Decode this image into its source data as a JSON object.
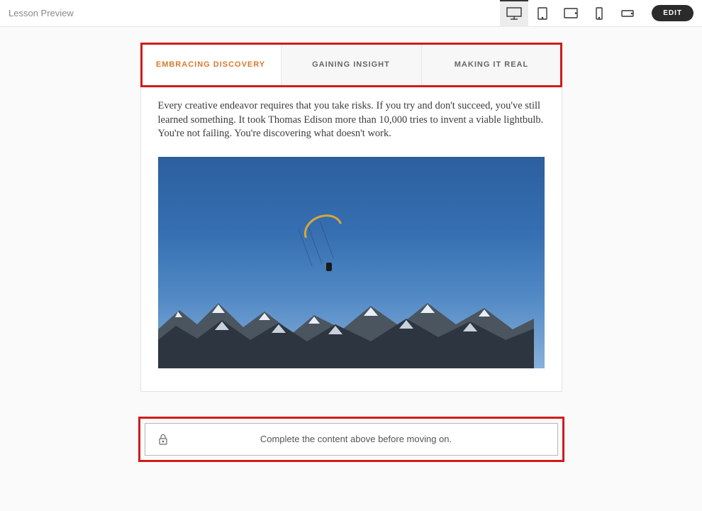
{
  "topbar": {
    "title": "Lesson Preview",
    "edit_label": "EDIT"
  },
  "tabs": [
    {
      "label": "EMBRACING DISCOVERY",
      "active": true
    },
    {
      "label": "GAINING INSIGHT",
      "active": false
    },
    {
      "label": "MAKING IT REAL",
      "active": false
    }
  ],
  "body_text": "Every creative endeavor requires that you take risks. If you try and don't succeed, you've still learned something. It took Thomas Edison more than 10,000 tries to invent a viable lightbulb. You're not failing. You're discovering what doesn't work.",
  "lock_message": "Complete the content above before moving on."
}
